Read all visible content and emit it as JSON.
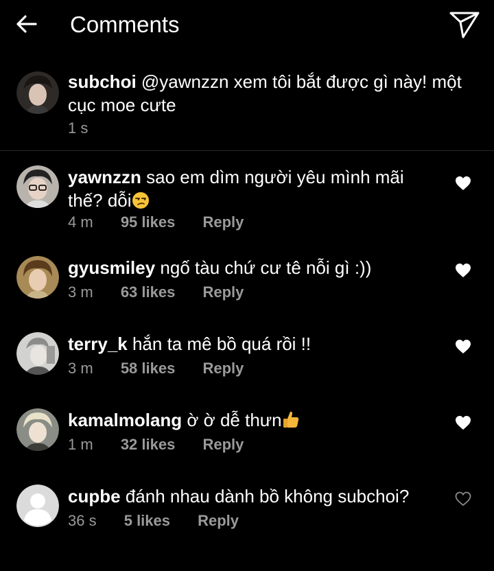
{
  "header": {
    "title": "Comments"
  },
  "caption": {
    "username": "subchoi",
    "text": "@yawnzzn xem tôi bắt được gì này! một cục moe cưte",
    "time": "1 s"
  },
  "comments": [
    {
      "username": "yawnzzn",
      "text": "sao em dìm người yêu mình mãi thế? dỗi",
      "emoji": "unamused-face",
      "time": "4 m",
      "likes": "95 likes",
      "reply": "Reply",
      "liked": true
    },
    {
      "username": "gyusmiley",
      "text": "ngố tàu chứ cư tê nỗi gì :))",
      "time": "3 m",
      "likes": "63 likes",
      "reply": "Reply",
      "liked": true
    },
    {
      "username": "terry_k",
      "text": "hắn ta mê bồ quá rồi !!",
      "time": "3 m",
      "likes": "58 likes",
      "reply": "Reply",
      "liked": true
    },
    {
      "username": "kamalmolang",
      "text": "ờ ờ dễ thưn",
      "emoji": "thumbs-up",
      "time": "1 m",
      "likes": "32 likes",
      "reply": "Reply",
      "liked": true
    },
    {
      "username": "cupbe",
      "text": "đánh nhau dành bồ không subchoi?",
      "time": "36 s",
      "likes": "5 likes",
      "reply": "Reply",
      "liked": false
    }
  ],
  "colors": {
    "background": "#000000",
    "text": "#ffffff",
    "muted": "#9a9a9a",
    "divider": "#2a2a2a"
  }
}
